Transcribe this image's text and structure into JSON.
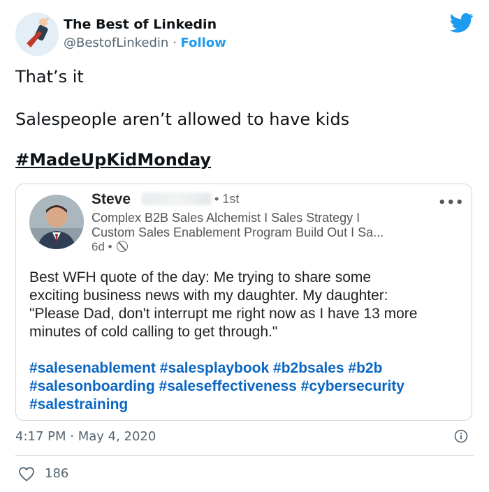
{
  "author": {
    "name": "The Best of Linkedin",
    "handle": "@BestofLinkedin",
    "separator": " · ",
    "follow_label": "Follow"
  },
  "tweet": {
    "lines": [
      "That’s it",
      "Salespeople aren’t allowed to have kids"
    ],
    "hashtag": "#MadeUpKidMonday",
    "timestamp": "4:17 PM · May 4, 2020",
    "likes": "186"
  },
  "embed": {
    "name": "Steve",
    "degree": "• 1st",
    "more": "•••",
    "headline": [
      "Complex B2B Sales Alchemist I Sales Strategy I",
      "Custom Sales Enablement Program Build Out I Sa..."
    ],
    "time": "6d •",
    "body": [
      "Best WFH quote of the day: Me trying to share some",
      "exciting business news with my daughter. My daughter:",
      "\"Please Dad, don't interrupt me right now as I have 13 more",
      "minutes of cold calling to get through.\""
    ],
    "hashtags": [
      "#salesenablement #salesplaybook #b2bsales #b2b",
      "#salesonboarding #saleseffectiveness #cybersecurity",
      "#salestraining"
    ]
  },
  "icons": {
    "brand": "twitter-bird-icon",
    "info": "info-icon",
    "like": "heart-icon",
    "visibility": "globe-icon"
  },
  "colors": {
    "accent": "#1d9bf0",
    "link_blue": "#0a66c2",
    "muted": "#536471"
  }
}
